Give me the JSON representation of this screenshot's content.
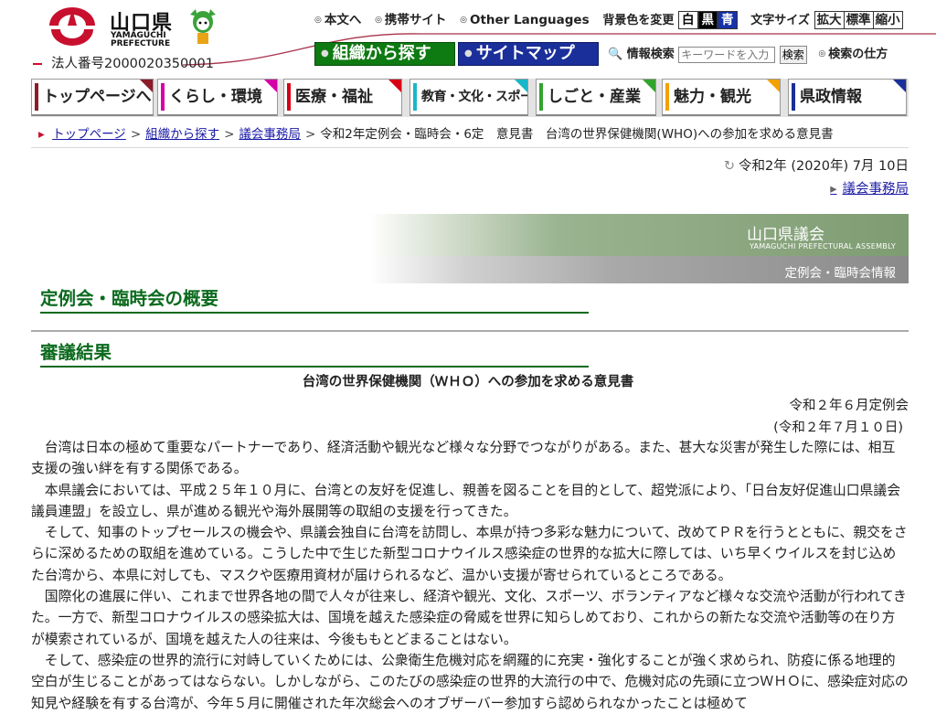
{
  "header": {
    "logo_jp": "山口県",
    "logo_en": "YAMAGUCHI PREFECTURE",
    "corp_number": "法人番号2000020350001",
    "links": [
      "本文へ",
      "携帯サイト",
      "Other Languages"
    ],
    "bg_label": "背景色を変更",
    "bg_options": [
      "白",
      "黒",
      "青"
    ],
    "font_label": "文字サイズ",
    "font_options": [
      "拡大",
      "標準",
      "縮小"
    ],
    "org_button": "組織から探す",
    "sitemap_button": "サイトマップ",
    "search_label": "情報検索",
    "search_placeholder": "キーワードを入力",
    "search_button": "検索",
    "search_help": "検索の仕方"
  },
  "gnav": [
    {
      "label": "トップページへ",
      "color": "#8c1c2a"
    },
    {
      "label": "くらし・環境",
      "color": "#d400a8"
    },
    {
      "label": "医療・福祉",
      "color": "#d60015"
    },
    {
      "label": "教育・文化・スポーツ",
      "color": "#19b7c8"
    },
    {
      "label": "しごと・産業",
      "color": "#33a32d"
    },
    {
      "label": "魅力・観光",
      "color": "#f2a100"
    },
    {
      "label": "県政情報",
      "color": "#1a2f9a"
    }
  ],
  "breadcrumb": [
    {
      "label": "トップページ",
      "link": true
    },
    {
      "label": "組織から探す",
      "link": true
    },
    {
      "label": "議会事務局",
      "link": true
    },
    {
      "label": "令和2年定例会・臨時会・6定　意見書　台湾の世界保健機関(WHO)への参加を求める意見書",
      "link": false
    }
  ],
  "updated": "令和2年 (2020年) 7月 10日",
  "department": "議会事務局",
  "banner": {
    "title": "山口県議会",
    "subtitle": "YAMAGUCHI PREFECTURAL ASSEMBLY",
    "link": "定例会・臨時会情報"
  },
  "headings": {
    "overview": "定例会・臨時会の概要",
    "results": "審議結果"
  },
  "document": {
    "title": "台湾の世界保健機関（ＷＨＯ）への参加を求める意見書",
    "session": "令和２年６月定例会",
    "date": "(令和２年７月１０日)",
    "paragraphs": [
      "台湾は日本の極めて重要なパートナーであり、経済活動や観光など様々な分野でつながりがある。また、甚大な災害が発生した際には、相互支援の強い絆を有する関係である。",
      "本県議会においては、平成２５年１０月に、台湾との友好を促進し、親善を図ることを目的として、超党派により、「日台友好促進山口県議会議員連盟」を設立し、県が進める観光や海外展開等の取組の支援を行ってきた。",
      "そして、知事のトップセールスの機会や、県議会独自に台湾を訪問し、本県が持つ多彩な魅力について、改めてＰＲを行うとともに、親交をさらに深めるための取組を進めている。こうした中で生じた新型コロナウイルス感染症の世界的な拡大に際しては、いち早くウイルスを封じ込めた台湾から、本県に対しても、マスクや医療用資材が届けられるなど、温かい支援が寄せられているところである。",
      "国際化の進展に伴い、これまで世界各地の間で人々が往来し、経済や観光、文化、スポーツ、ボランティアなど様々な交流や活動が行われてきた。一方で、新型コロナウイルスの感染拡大は、国境を越えた感染症の脅威を世界に知らしめており、これからの新たな交流や活動等の在り方が模索されているが、国境を越えた人の往来は、今後ももとどまることはない。",
      "そして、感染症の世界的流行に対峙していくためには、公衆衛生危機対応を網羅的に充実・強化することが強く求められ、防疫に係る地理的空白が生じることがあってはならない。しかしながら、このたびの感染症の世界的大流行の中で、危機対応の先頭に立つＷＨＯに、感染症対応の知見や経験を有する台湾が、今年５月に開催された年次総会へのオブザーバー参加すら認められなかったことは極めて"
    ]
  }
}
